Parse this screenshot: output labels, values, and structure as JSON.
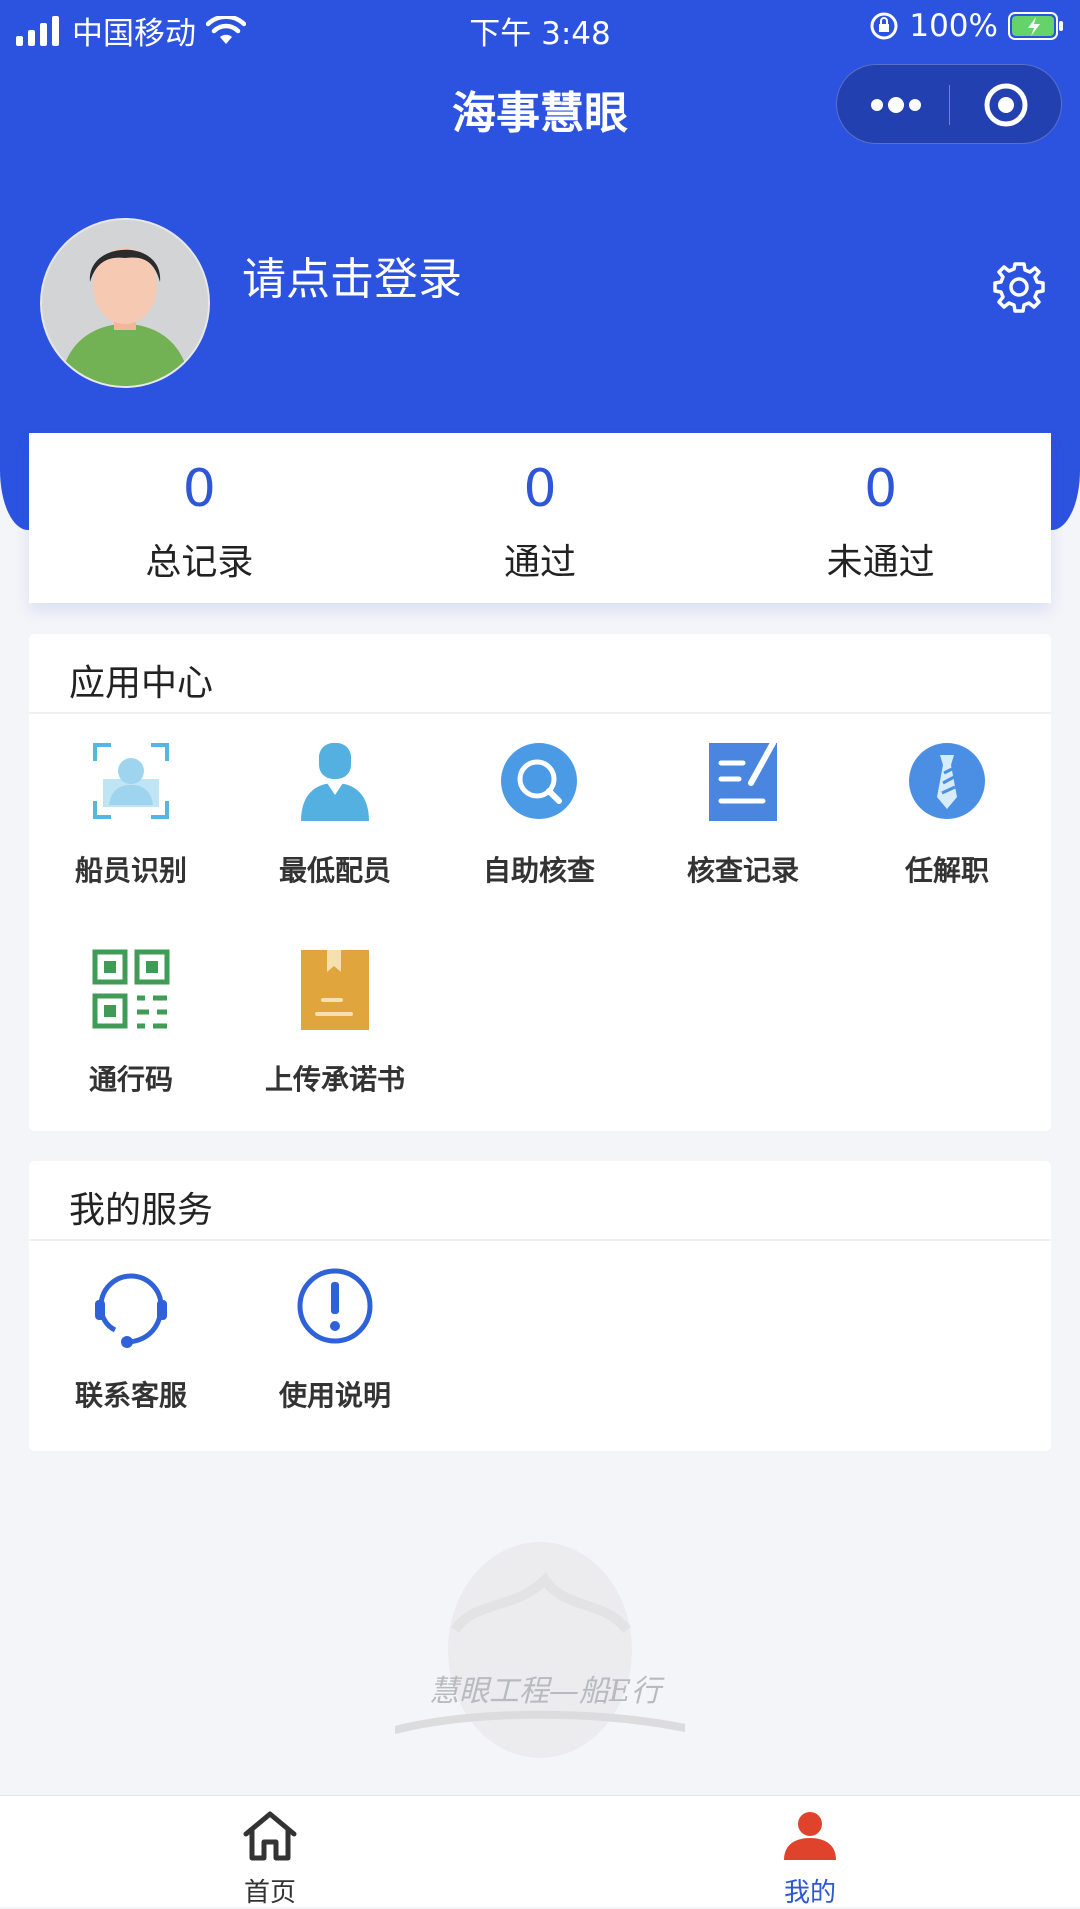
{
  "status_bar": {
    "carrier": "中国移动",
    "time": "下午 3:48",
    "battery": "100%"
  },
  "nav": {
    "title": "海事慧眼"
  },
  "profile": {
    "login_prompt": "请点击登录"
  },
  "stats": [
    {
      "value": "0",
      "label": "总记录"
    },
    {
      "value": "0",
      "label": "通过"
    },
    {
      "value": "0",
      "label": "未通过"
    }
  ],
  "app_center": {
    "title": "应用中心",
    "items": [
      {
        "label": "船员识别",
        "icon": "face-scan-icon"
      },
      {
        "label": "最低配员",
        "icon": "crew-person-icon"
      },
      {
        "label": "自助核查",
        "icon": "search-check-icon"
      },
      {
        "label": "核查记录",
        "icon": "record-edit-icon"
      },
      {
        "label": "任解职",
        "icon": "tie-icon"
      },
      {
        "label": "通行码",
        "icon": "qr-code-icon"
      },
      {
        "label": "上传承诺书",
        "icon": "bookmark-document-icon"
      }
    ]
  },
  "my_services": {
    "title": "我的服务",
    "items": [
      {
        "label": "联系客服",
        "icon": "headset-icon"
      },
      {
        "label": "使用说明",
        "icon": "info-exclamation-icon"
      }
    ]
  },
  "watermark": {
    "text": "慧眼工程—船E行"
  },
  "tabbar": {
    "items": [
      {
        "label": "首页",
        "icon": "home-icon",
        "active": false
      },
      {
        "label": "我的",
        "icon": "user-icon",
        "active": true
      }
    ]
  },
  "colors": {
    "primary": "#2c52e0",
    "stat_number": "#2d57d8",
    "tab_active": "#e0432c",
    "tab_inactive": "#333333"
  }
}
